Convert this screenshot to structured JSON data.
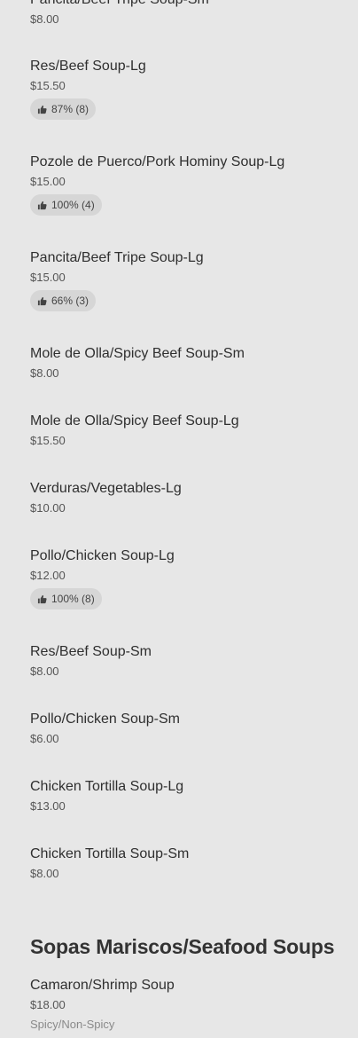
{
  "menu": {
    "items": [
      {
        "name": "Pancita/Beef Tripe Soup-Sm",
        "price": "$8.00"
      },
      {
        "name": "Res/Beef Soup-Lg",
        "price": "$15.50",
        "rating": "87% (8)"
      },
      {
        "name": "Pozole de Puerco/Pork Hominy Soup-Lg",
        "price": "$15.00",
        "rating": "100% (4)"
      },
      {
        "name": "Pancita/Beef Tripe Soup-Lg",
        "price": "$15.00",
        "rating": "66% (3)"
      },
      {
        "name": "Mole de Olla/Spicy Beef Soup-Sm",
        "price": "$8.00"
      },
      {
        "name": "Mole de Olla/Spicy Beef Soup-Lg",
        "price": "$15.50"
      },
      {
        "name": "Verduras/Vegetables-Lg",
        "price": "$10.00"
      },
      {
        "name": "Pollo/Chicken Soup-Lg",
        "price": "$12.00",
        "rating": "100% (8)"
      },
      {
        "name": "Res/Beef Soup-Sm",
        "price": "$8.00"
      },
      {
        "name": "Pollo/Chicken Soup-Sm",
        "price": "$6.00"
      },
      {
        "name": "Chicken Tortilla Soup-Lg",
        "price": "$13.00"
      },
      {
        "name": "Chicken Tortilla Soup-Sm",
        "price": "$8.00"
      }
    ],
    "seafood_section": {
      "title": "Sopas Mariscos/Seafood Soups",
      "items": [
        {
          "name": "Camaron/Shrimp Soup",
          "price": "$18.00",
          "description": "Spicy/Non-Spicy"
        }
      ]
    }
  },
  "colors": {
    "background": "#e7e7e7",
    "badge": "#d6d6d6"
  },
  "icons": {
    "rating": "thumbs-up-icon"
  }
}
